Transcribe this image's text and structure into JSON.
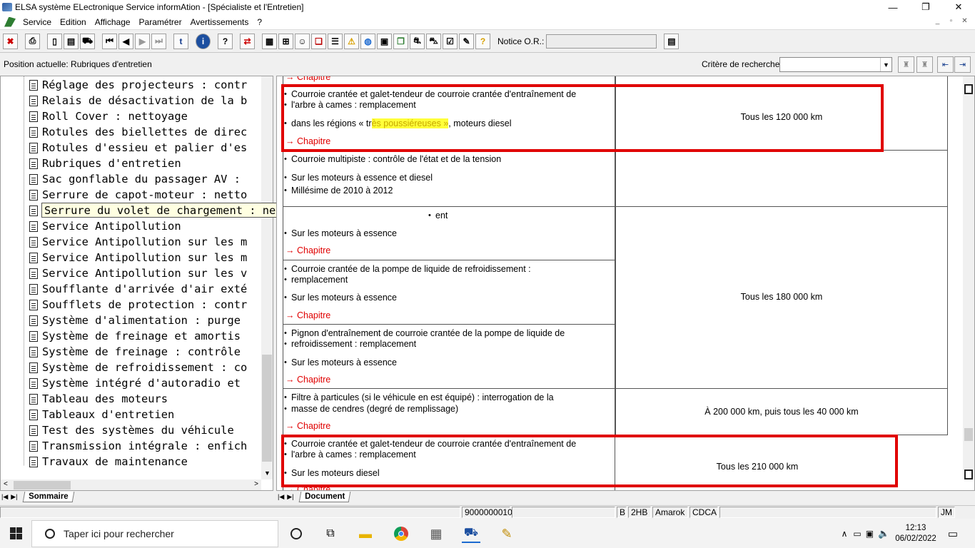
{
  "window": {
    "title": "ELSA système ELectronique Service informAtion - [Spécialiste et l'Entretien]",
    "controls": [
      "—",
      "❐",
      "✕"
    ]
  },
  "menu": {
    "items": [
      "Service",
      "Edition",
      "Affichage",
      "Paramétrer",
      "Avertissements",
      "?"
    ],
    "mdi_controls": [
      "_",
      "▫",
      "✕"
    ]
  },
  "toolbar": {
    "notice_label": "Notice O.R.:",
    "notice_value": ""
  },
  "position": {
    "label": "Position actuelle: Rubriques d'entretien",
    "criteria_label": "Critère de recherche:",
    "criteria_value": ""
  },
  "tree": {
    "items": [
      "Réglage des projecteurs : contr",
      "Relais de désactivation de la b",
      "Roll Cover : nettoyage",
      "Rotules des biellettes de direc",
      "Rotules d'essieu et palier d'es",
      "Rubriques d'entretien",
      "Sac gonflable du passager AV :",
      "Serrure de capot-moteur : netto",
      "Serrure du volet de chargement",
      "Service Antipollution",
      "Service Antipollution sur les m",
      "Service Antipollution sur les m",
      "Service Antipollution sur les v",
      "Soufflante d'arrivée d'air exté",
      "Soufflets de protection : contr",
      "Système d'alimentation : purge",
      "Système de freinage et amortis",
      "Système de freinage : contrôle",
      "Système de refroidissement : co",
      "Système intégré d'autoradio et",
      "Tableau des moteurs",
      "Tableaux d'entretien",
      "Test des systèmes du véhicule",
      "Transmission intégrale : enfich",
      "Travaux de maintenance"
    ],
    "tooltip": "Serrure du volet de chargement : nettoyage et graissage",
    "tab_label": "Sommaire"
  },
  "document": {
    "tab_label": "Document",
    "chapter_link": "→ Chapitre",
    "rows": {
      "r1": {
        "line1": "Courroie crantée et galet-tendeur de courroie crantée d'entraînement de",
        "line2": "l'arbre à cames : remplacement",
        "cond_a": "dans les régions « tr",
        "cond_hl": "ès poussiéreuses »",
        "cond_b": ", moteurs diesel",
        "interval": "Tous les 120 000 km"
      },
      "r2": {
        "line1": "Courroie multipiste : contrôle de l'état et de la tension",
        "cond1": "Sur les moteurs à essence et diesel",
        "cond2": "Millésime de 2010 à 2012"
      },
      "r3": {
        "line1": "ent",
        "cond1": "Sur les moteurs à essence"
      },
      "r4": {
        "line1": "Courroie crantée de la pompe de liquide de refroidissement  :",
        "line2": "remplacement",
        "cond1": "Sur les moteurs à essence",
        "interval": "Tous les 180 000 km"
      },
      "r5": {
        "line1": "Pignon d'entraînement de courroie crantée de la pompe de liquide de",
        "line2": "refroidissement : remplacement",
        "cond1": "Sur les moteurs à essence"
      },
      "r6": {
        "line1": "Filtre à particules (si le véhicule en est équipé) : interrogation de la",
        "line2": "masse de cendres (degré de remplissage)",
        "interval": "À 200 000 km, puis tous les 40 000 km"
      },
      "r7": {
        "line1": "Courroie crantée et galet-tendeur de courroie crantée d'entraînement de",
        "line2": "l'arbre à cames : remplacement",
        "cond1": "Sur les moteurs diesel",
        "interval": "Tous les 210 000 km"
      }
    }
  },
  "status": {
    "order": "9000000010",
    "c1": "B",
    "c2": "2HB",
    "c3": "Amarok",
    "c4": "CDCA",
    "user": "JM"
  },
  "taskbar": {
    "search_placeholder": "Taper ici pour rechercher",
    "time": "12:13",
    "date": "06/02/2022"
  },
  "colors": {
    "highlight_box": "#e00000",
    "chapter_link": "#e00000",
    "text_highlight": "#ffff3a"
  }
}
